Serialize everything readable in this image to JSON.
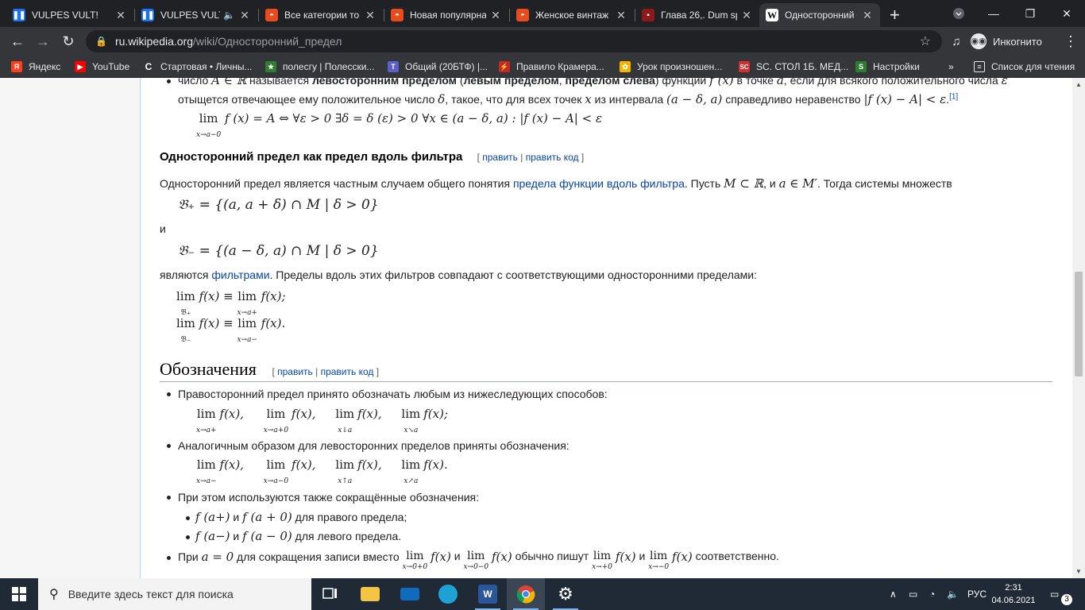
{
  "browser": {
    "tabs": [
      {
        "title": "VULPES VULT!",
        "icon": "pause-icon",
        "color": "#1a73e8"
      },
      {
        "title": "VULPES VULT",
        "icon": "pause-icon",
        "color": "#1a73e8",
        "audio": "🔈"
      },
      {
        "title": "Все категории то",
        "icon": "shop-icon",
        "color": "#e84c1e"
      },
      {
        "title": "Новая популярна",
        "icon": "shop-icon",
        "color": "#e84c1e"
      },
      {
        "title": "Женское винтаж",
        "icon": "shop-icon",
        "color": "#e84c1e"
      },
      {
        "title": "Глава 26,. Dum sp",
        "icon": "book-icon",
        "color": "#8b1a1a"
      },
      {
        "title": "Односторонний",
        "icon": "wikipedia-icon",
        "color": "#ffffff",
        "active": true
      }
    ],
    "url_host": "ru.wikipedia.org",
    "url_path": "/wiki/Односторонний_предел",
    "incognito_label": "Инкогнито",
    "bookmarks": [
      {
        "label": "Яндекс",
        "color": "#fc3f1d",
        "glyph": "Я"
      },
      {
        "label": "YouTube",
        "color": "#ff0000",
        "glyph": "▶"
      },
      {
        "label": "Стартовая • Личны...",
        "color": "#35363a",
        "glyph": "C"
      },
      {
        "label": "полесгу | Полесски...",
        "color": "#2e7d32",
        "glyph": "★"
      },
      {
        "label": "Общий (20БТФ) |...",
        "color": "#5b5fc7",
        "glyph": "T"
      },
      {
        "label": "Правило Крамера...",
        "color": "#c62828",
        "glyph": "⚡"
      },
      {
        "label": "Урок произношен...",
        "color": "#f4b400",
        "glyph": "✿"
      },
      {
        "label": "SC. СТОЛ 1Б. МЕД...",
        "color": "#d32f2f",
        "glyph": "SC"
      },
      {
        "label": "Настройки",
        "color": "#2e7d32",
        "glyph": "S"
      }
    ],
    "reading_list": "Список для чтения"
  },
  "article": {
    "top_bullet_line1_a": "число ",
    "top_bullet_line1_b": "A ∈ ℝ",
    "top_bullet_line1_c": " называется ",
    "top_bullet_line1_d": "левосторонним пределом",
    "top_bullet_line1_e": " (",
    "top_bullet_line1_f": "левым пределом",
    "top_bullet_line1_g": ", ",
    "top_bullet_line1_h": "пределом слева",
    "top_bullet_line1_i": ") функции ",
    "top_bullet_line1_j": "f (x)",
    "top_bullet_line1_k": " в точке ",
    "top_bullet_line1_l": "a",
    "top_bullet_line1_m": ", если для всякого положительного числа ",
    "top_bullet_line1_n": "ε",
    "top_bullet_line2_a": "отыщется отвечающее ему положительное число ",
    "top_bullet_line2_b": "δ",
    "top_bullet_line2_c": ", такое, что для всех точек ",
    "top_bullet_line2_d": "x",
    "top_bullet_line2_e": " из интервала ",
    "top_bullet_line2_f": "(a − δ, a)",
    "top_bullet_line2_g": " справедливо неравенство ",
    "top_bullet_line2_h": "|f (x) − A| < ε",
    "top_bullet_line2_i": ".",
    "top_bullet_ref": "[1]",
    "formula_left_lim": "lim",
    "formula_left_sub": "x→a−0",
    "formula_left_rest": "f (x) = A ⇔ ∀ε > 0 ∃δ = δ (ε) > 0 ∀x ∈ (a − δ, a) : |f (x) − A| < ε",
    "section1_title": "Односторонний предел как предел вдоль фильтра",
    "edit_open": "[ ",
    "edit_label": "править",
    "edit_sep": " | ",
    "edit_code_label": "править код",
    "edit_close": " ]",
    "s1_p1_a": "Односторонний предел является частным случаем общего понятия ",
    "s1_p1_link": "предела функции вдоль фильтра",
    "s1_p1_b": ". Пусть ",
    "s1_p1_c": "M ⊂ ℝ",
    "s1_p1_d": ", и ",
    "s1_p1_e": "a ∈ M′",
    "s1_p1_f": ". Тогда системы множеств",
    "s1_formula1": "𝔅₊ = {(a, a + δ) ∩ M | δ > 0}",
    "s1_and": "и",
    "s1_formula2": "𝔅₋ = {(a − δ, a) ∩ M | δ > 0}",
    "s1_p2_a": "являются ",
    "s1_p2_link": "фильтрами",
    "s1_p2_b": ". Пределы вдоль этих фильтров совпадают с соответствующими односторонними пределами:",
    "s1_lim1_a_sub": "𝔅₊",
    "s1_lim1_a": "f(x) ≡",
    "s1_lim1_b_sub": "x→a+",
    "s1_lim1_b": "f(x);",
    "s1_lim2_a_sub": "𝔅₋",
    "s1_lim2_a": "f(x) ≡",
    "s1_lim2_b_sub": "x→a−",
    "s1_lim2_b": "f(x).",
    "lim": "lim",
    "section2_title": "Обозначения",
    "s2_b1": "Правосторонний предел принято обозначать любым из нижеследующих способов:",
    "s2_f1": [
      {
        "sub": "x→a+",
        "rest": "f(x),"
      },
      {
        "sub": "x→a+0",
        "rest": "f(x),"
      },
      {
        "sub": "x↓a",
        "rest": "f(x),"
      },
      {
        "sub": "x↘a",
        "rest": "f(x);"
      }
    ],
    "s2_b2": "Аналогичным образом для левосторонних пределов приняты обозначения:",
    "s2_f2": [
      {
        "sub": "x→a−",
        "rest": "f(x),"
      },
      {
        "sub": "x→a−0",
        "rest": "f(x),"
      },
      {
        "sub": "x↑a",
        "rest": "f(x),"
      },
      {
        "sub": "x↗a",
        "rest": "f(x)."
      }
    ],
    "s2_b3": "При этом используются также сокращённые обозначения:",
    "s2_sub1_a": "f (a+)",
    "s2_sub1_b": " и ",
    "s2_sub1_c": "f (a + 0)",
    "s2_sub1_d": " для правого предела;",
    "s2_sub2_a": "f (a−)",
    "s2_sub2_b": " и ",
    "s2_sub2_c": "f (a − 0)",
    "s2_sub2_d": " для левого предела.",
    "s2_b4_a": "При ",
    "s2_b4_b": "a = 0",
    "s2_b4_c": " для сокращения записи вместо ",
    "s2_b4_l1": "x→0+0",
    "s2_b4_d": " и ",
    "s2_b4_l2": "x→0−0",
    "s2_b4_e": " обычно пишут ",
    "s2_b4_l3": "x→+0",
    "s2_b4_f": " и ",
    "s2_b4_l4": "x→−0",
    "s2_b4_g": " соответственно.",
    "fx": "f(x)"
  },
  "taskbar": {
    "search_placeholder": "Введите здесь текст для поиска",
    "lang": "РУС",
    "time": "2:31",
    "date": "04.06.2021",
    "notifications": "3"
  }
}
